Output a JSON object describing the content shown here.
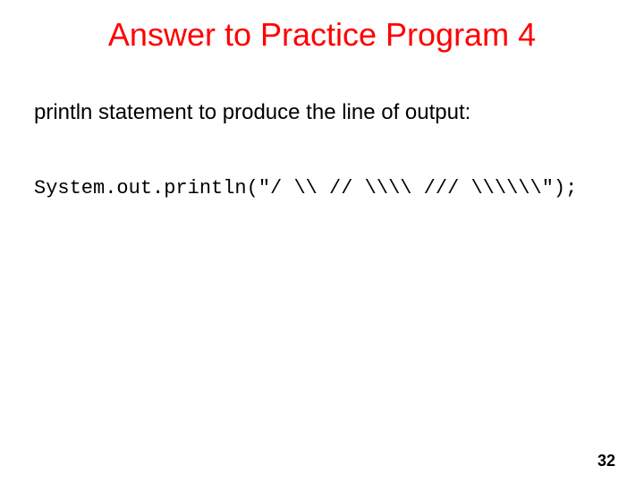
{
  "title": "Answer to Practice Program 4",
  "body": "println statement to produce the line of output:",
  "code": "System.out.println(\"/ \\\\ // \\\\\\\\ /// \\\\\\\\\\\\\");",
  "page_number": "32"
}
